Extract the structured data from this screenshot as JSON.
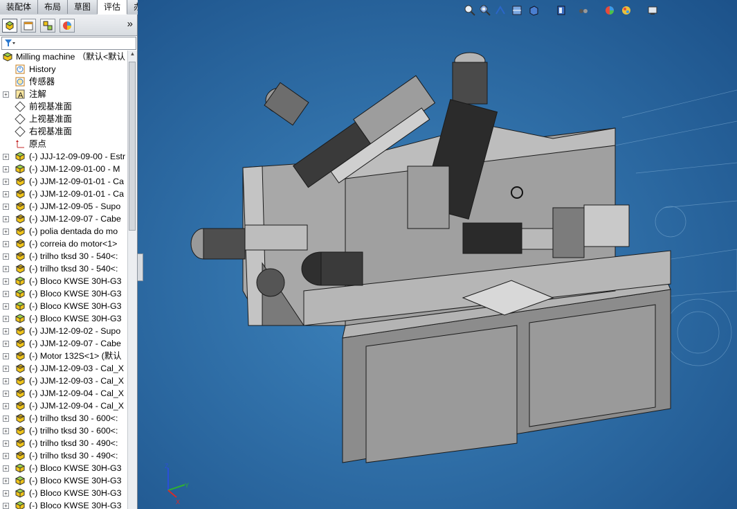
{
  "tabs": [
    {
      "label": "装配体",
      "active": false
    },
    {
      "label": "布局",
      "active": false
    },
    {
      "label": "草图",
      "active": false
    },
    {
      "label": "评估",
      "active": true
    },
    {
      "label": "办公室产品",
      "active": false
    }
  ],
  "panel": {
    "tabs": [
      "featuremanager-icon",
      "propertymanager-icon",
      "configurationmanager-icon",
      "displaymanager-icon"
    ],
    "more": "»"
  },
  "tree": {
    "root": "Milling machine （默认<默认",
    "items": [
      {
        "label": "History",
        "icon": "history-icon"
      },
      {
        "label": "传感器",
        "icon": "sensor-icon"
      },
      {
        "label": "注解",
        "icon": "annotation-icon",
        "expand": true
      },
      {
        "label": "前视基准面",
        "icon": "plane-icon"
      },
      {
        "label": "上视基准面",
        "icon": "plane-icon"
      },
      {
        "label": "右视基准面",
        "icon": "plane-icon"
      },
      {
        "label": "原点",
        "icon": "origin-icon"
      },
      {
        "label": "(-) JJJ-12-09-09-00 - Estr",
        "icon": "subassembly-icon",
        "expand": true
      },
      {
        "label": "(-) JJM-12-09-01-00 - M",
        "icon": "subassembly-icon",
        "expand": true
      },
      {
        "label": "(-) JJM-12-09-01-01 - Ca",
        "icon": "part-icon",
        "expand": true
      },
      {
        "label": "(-) JJM-12-09-01-01 - Ca",
        "icon": "part-icon",
        "expand": true
      },
      {
        "label": "(-) JJM-12-09-05 - Supo",
        "icon": "part-icon",
        "expand": true
      },
      {
        "label": "(-) JJM-12-09-07 - Cabe",
        "icon": "part-icon",
        "expand": true
      },
      {
        "label": "(-) polia dentada do mo",
        "icon": "part-icon",
        "expand": true
      },
      {
        "label": "(-) correia do motor<1>",
        "icon": "part-icon",
        "expand": true
      },
      {
        "label": "(-) trilho tksd 30 - 540<:",
        "icon": "part-icon",
        "expand": true
      },
      {
        "label": "(-) trilho tksd 30 - 540<:",
        "icon": "part-icon",
        "expand": true
      },
      {
        "label": "(-) Bloco KWSE 30H-G3",
        "icon": "subassembly-icon",
        "expand": true
      },
      {
        "label": "(-) Bloco KWSE 30H-G3",
        "icon": "subassembly-icon",
        "expand": true
      },
      {
        "label": "(-) Bloco KWSE 30H-G3",
        "icon": "subassembly-icon",
        "expand": true
      },
      {
        "label": "(-) Bloco KWSE 30H-G3",
        "icon": "subassembly-icon",
        "expand": true
      },
      {
        "label": "(-) JJM-12-09-02 - Supo",
        "icon": "part-icon",
        "expand": true
      },
      {
        "label": "(-) JJM-12-09-07 - Cabe",
        "icon": "part-icon",
        "expand": true
      },
      {
        "label": "(-) Motor 132S<1> (默认",
        "icon": "part-icon",
        "expand": true
      },
      {
        "label": "(-) JJM-12-09-03 - Cal_X",
        "icon": "part-icon",
        "expand": true
      },
      {
        "label": "(-) JJM-12-09-03 - Cal_X",
        "icon": "part-icon",
        "expand": true
      },
      {
        "label": "(-) JJM-12-09-04 - Cal_X",
        "icon": "part-icon",
        "expand": true
      },
      {
        "label": "(-) JJM-12-09-04 - Cal_X",
        "icon": "part-icon",
        "expand": true
      },
      {
        "label": "(-) trilho tksd 30 - 600<:",
        "icon": "part-icon",
        "expand": true
      },
      {
        "label": "(-) trilho tksd 30 - 600<:",
        "icon": "part-icon",
        "expand": true
      },
      {
        "label": "(-) trilho tksd 30 - 490<:",
        "icon": "part-icon",
        "expand": true
      },
      {
        "label": "(-) trilho tksd 30 - 490<:",
        "icon": "part-icon",
        "expand": true
      },
      {
        "label": "(-) Bloco KWSE 30H-G3",
        "icon": "subassembly-icon",
        "expand": true
      },
      {
        "label": "(-) Bloco KWSE 30H-G3",
        "icon": "subassembly-icon",
        "expand": true
      },
      {
        "label": "(-) Bloco KWSE 30H-G3",
        "icon": "subassembly-icon",
        "expand": true
      },
      {
        "label": "(-) Bloco KWSE 30H-G3",
        "icon": "subassembly-icon",
        "expand": true
      }
    ]
  },
  "viewport": {
    "background_top": "#1b5088",
    "background_bottom": "#3f86bf",
    "triad": {
      "x": "X",
      "y": "Y",
      "z": "Z"
    }
  },
  "view_toolbar": [
    "zoom-to-fit-icon",
    "zoom-area-icon",
    "previous-view-icon",
    "section-view-icon",
    "view-orientation-icon",
    "display-style-icon",
    "hide-show-icon",
    "edit-appearance-icon",
    "apply-scene-icon",
    "view-settings-icon"
  ]
}
